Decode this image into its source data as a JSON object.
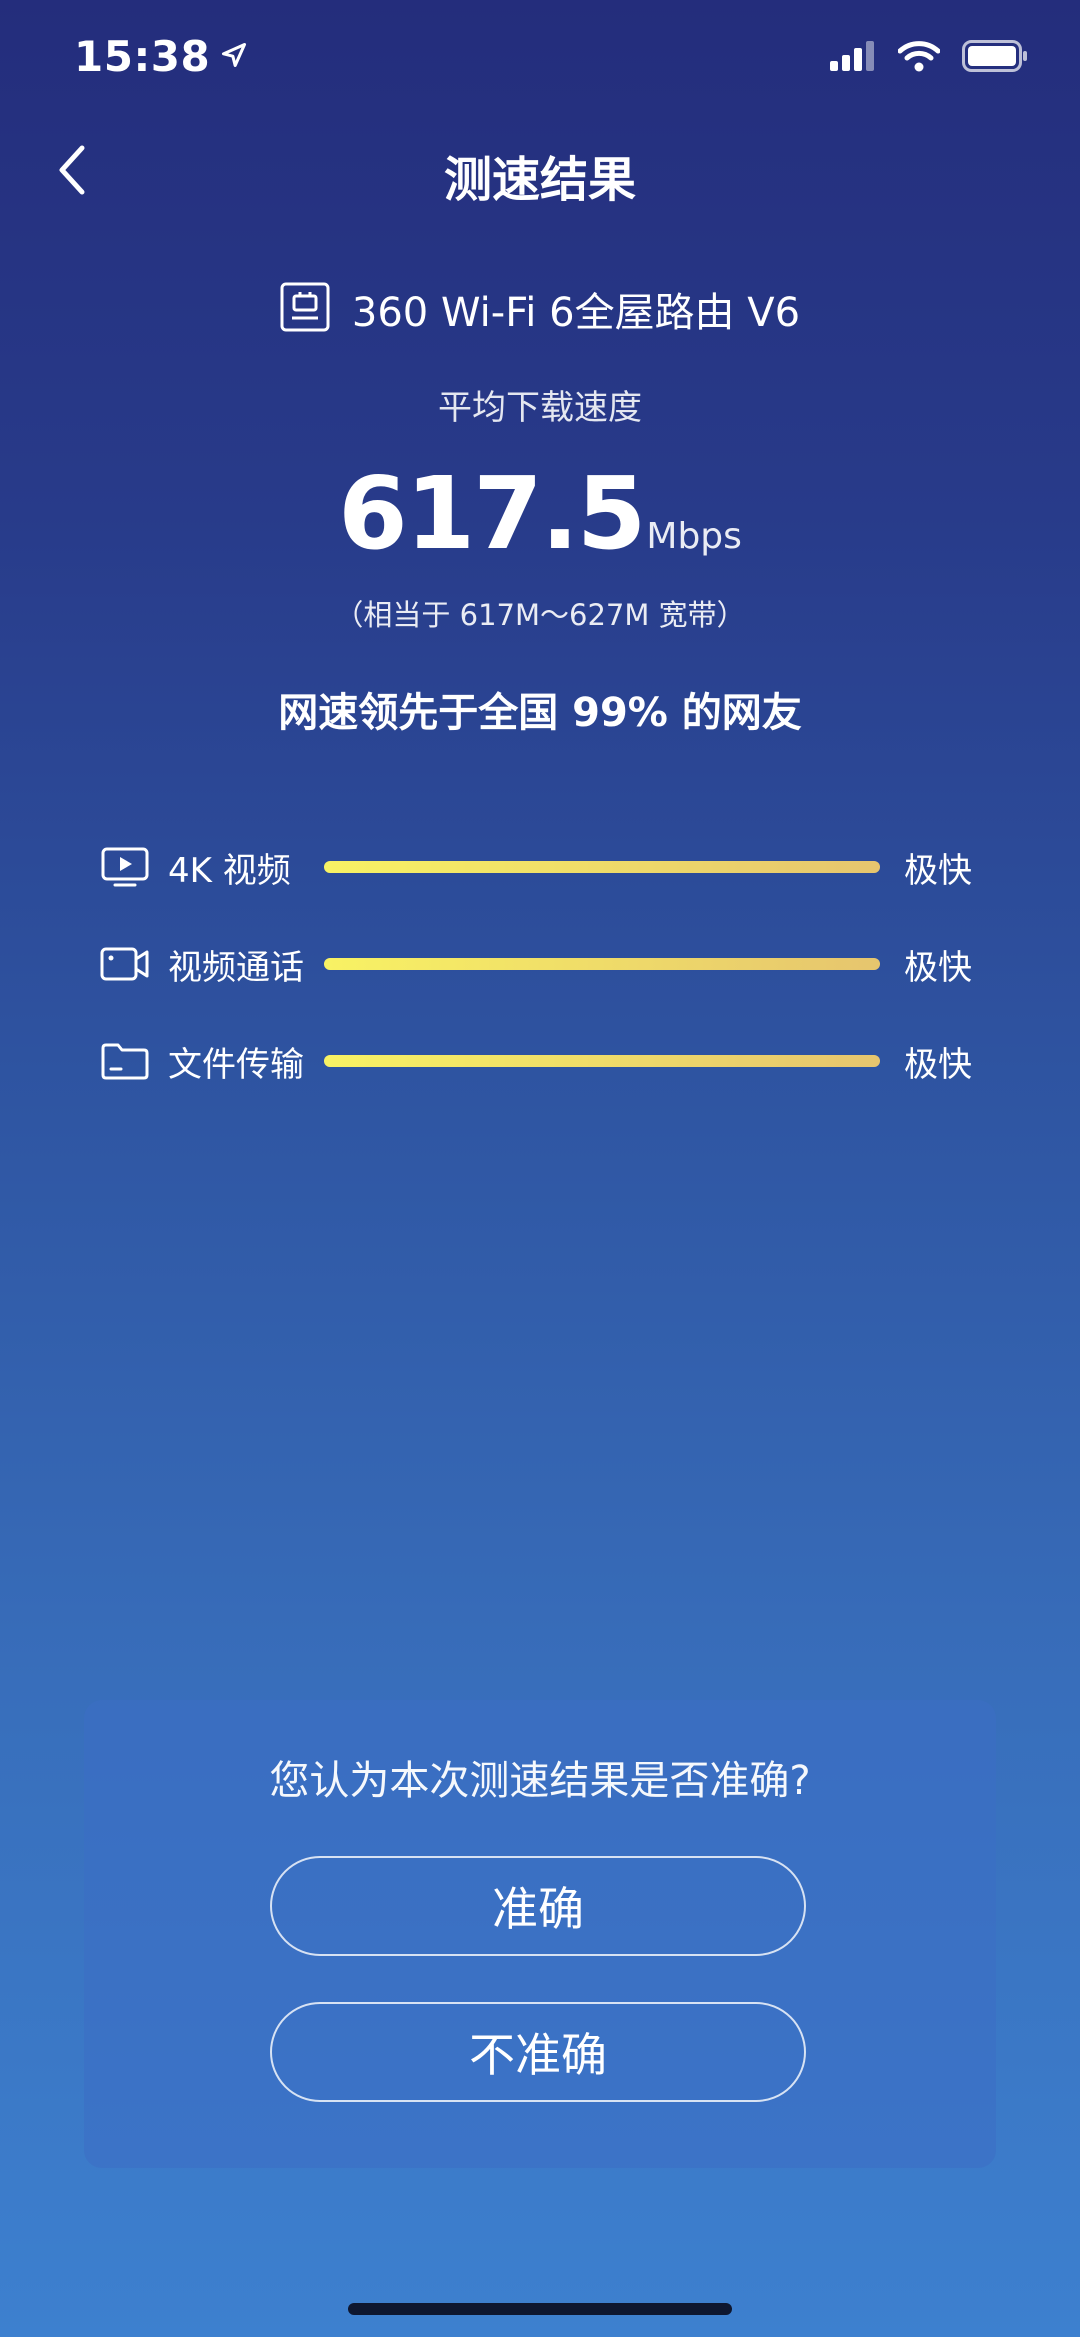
{
  "status_bar": {
    "time": "15:38"
  },
  "nav": {
    "title": "测速结果"
  },
  "device": {
    "name": "360 Wi-Fi 6全屋路由 V6",
    "icon": "router-icon"
  },
  "result": {
    "avg_label": "平均下载速度",
    "speed_value": "617.5",
    "speed_unit": "Mbps",
    "equivalent": "（相当于 617M～627M 宽带）",
    "lead_text": "网速领先于全国 99% 的网友"
  },
  "metrics": [
    {
      "icon": "tv-icon",
      "label": "4K 视频",
      "level": "极快",
      "fill_fraction": 1.0
    },
    {
      "icon": "video-camera-icon",
      "label": "视频通话",
      "level": "极快",
      "fill_fraction": 1.0
    },
    {
      "icon": "folder-icon",
      "label": "文件传输",
      "level": "极快",
      "fill_fraction": 1.0
    }
  ],
  "feedback": {
    "question": "您认为本次测速结果是否准确?",
    "accurate_label": "准确",
    "inaccurate_label": "不准确"
  },
  "colors": {
    "bar_start": "#f8f264",
    "bar_end": "#e6c56e",
    "bg_top": "#242d7c",
    "bg_bottom": "#3d80cf"
  }
}
